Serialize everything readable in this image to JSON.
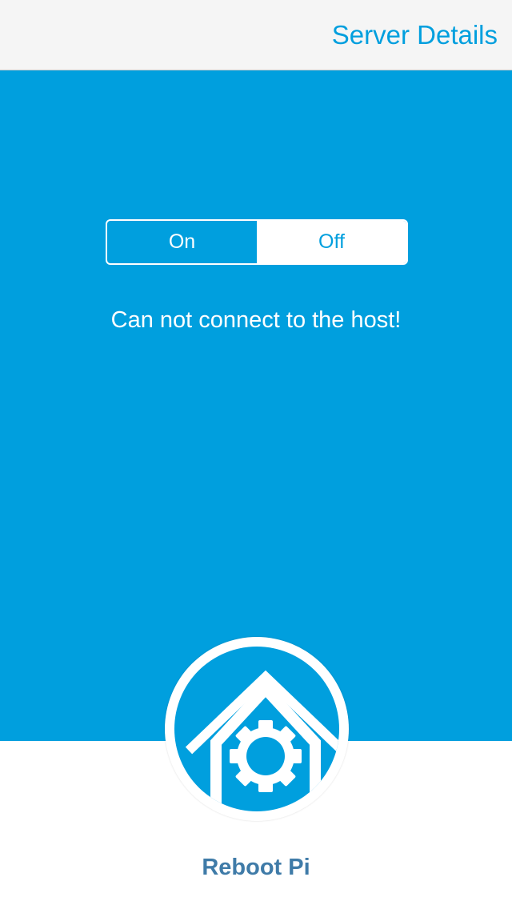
{
  "nav": {
    "action_label": "Server Details"
  },
  "power_toggle": {
    "on_label": "On",
    "off_label": "Off",
    "selected": "Off"
  },
  "status": {
    "message": "Can not connect to the host!"
  },
  "reboot": {
    "label": "Reboot Pi",
    "icon": "house-gear-icon"
  },
  "colors": {
    "accent": "#009fde",
    "nav_background": "#f5f5f5",
    "label_text": "#3f7ba8"
  }
}
